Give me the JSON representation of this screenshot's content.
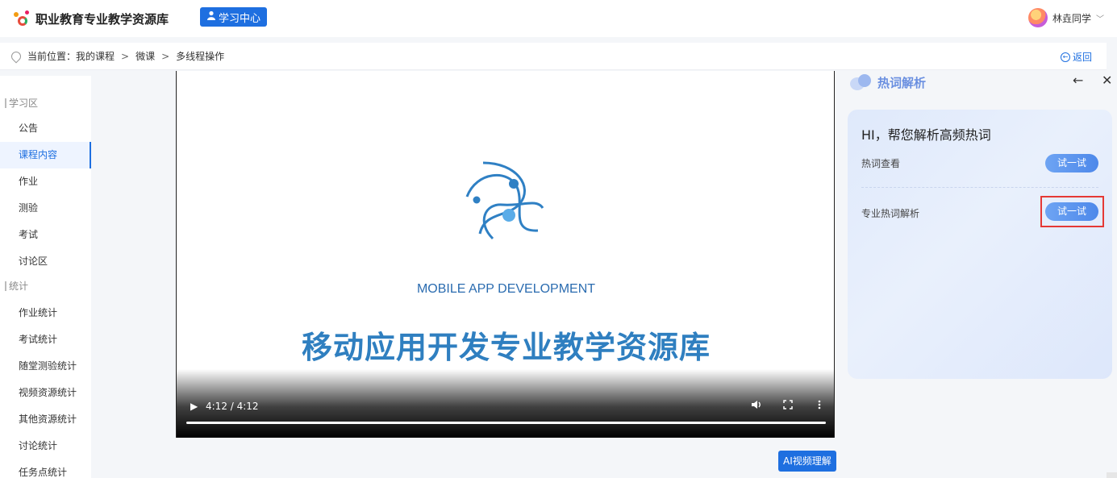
{
  "header": {
    "brand": "职业教育专业教学资源库",
    "study_center": "学习中心",
    "username": "林垚同学"
  },
  "breadcrumb": {
    "prefix": "当前位置：",
    "items": [
      "我的课程",
      "微课",
      "多线程操作"
    ],
    "back_label": "返回"
  },
  "sidebar": {
    "sections": [
      {
        "title": "学习区",
        "items": [
          "公告",
          "课程内容",
          "作业",
          "测验",
          "考试",
          "讨论区"
        ]
      },
      {
        "title": "统计",
        "items": [
          "作业统计",
          "考试统计",
          "随堂测验统计",
          "视频资源统计",
          "其他资源统计",
          "讨论统计",
          "任务点统计"
        ]
      }
    ],
    "active_item": "课程内容"
  },
  "video": {
    "subtitle": "MOBILE APP DEVELOPMENT",
    "title": "移动应用开发专业教学资源库",
    "time": "4:12 / 4:12",
    "progress": 1.0
  },
  "ai_button": "AI视频理解",
  "hotword_panel": {
    "title": "热词解析",
    "greeting": "HI，帮您解析高频热词",
    "rows": [
      {
        "label": "热词查看",
        "button": "试一试"
      },
      {
        "label": "专业热词解析",
        "button": "试一试"
      }
    ]
  },
  "colors": {
    "primary": "#1e6fe0",
    "video_title": "#2f7fc0",
    "highlight": "#e53935"
  }
}
